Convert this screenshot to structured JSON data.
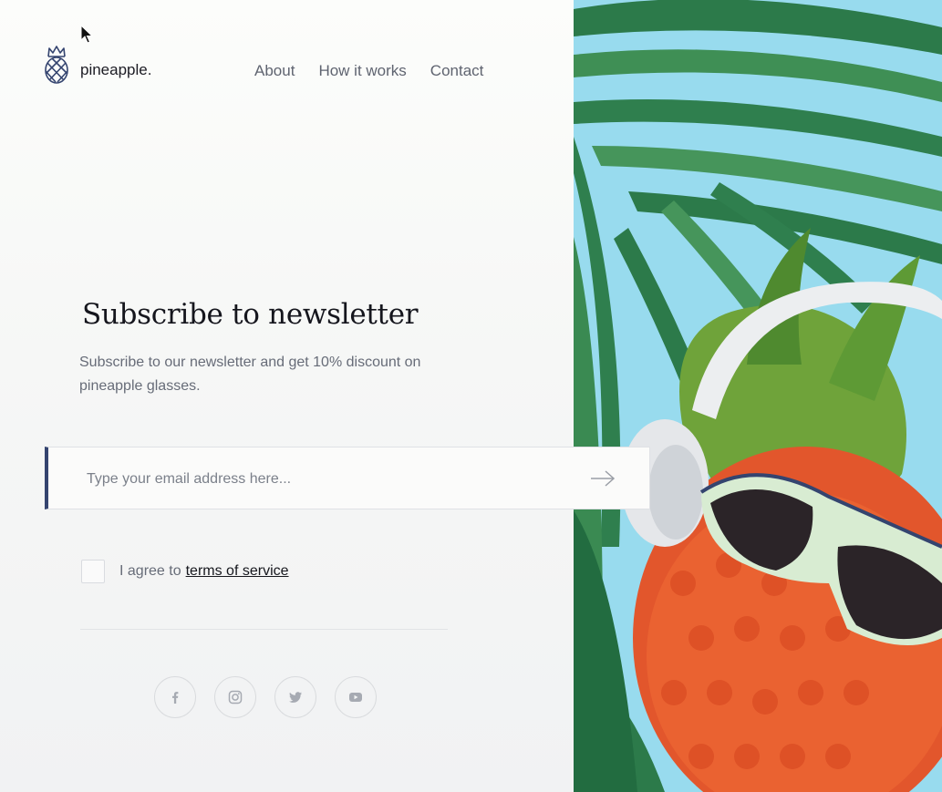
{
  "brand": {
    "name": "pineapple.",
    "icon": "pineapple-icon",
    "accent_color": "#34446f"
  },
  "nav": {
    "items": [
      {
        "label": "About"
      },
      {
        "label": "How it works"
      },
      {
        "label": "Contact"
      }
    ]
  },
  "newsletter": {
    "title": "Subscribe to newsletter",
    "description": "Subscribe to our newsletter and get 10% discount on pineapple glasses.",
    "email_placeholder": "Type your email address here...",
    "email_value": "",
    "submit_icon": "arrow-right-icon"
  },
  "agreement": {
    "prefix": "I agree to",
    "link_label": "terms of service",
    "checked": false
  },
  "socials": [
    {
      "icon": "facebook-icon"
    },
    {
      "icon": "instagram-icon"
    },
    {
      "icon": "twitter-icon"
    },
    {
      "icon": "youtube-icon"
    }
  ],
  "hero_image": {
    "subject": "pineapple with sunglasses and headphones on palm leaves",
    "background_color": "#8fd8ec"
  }
}
